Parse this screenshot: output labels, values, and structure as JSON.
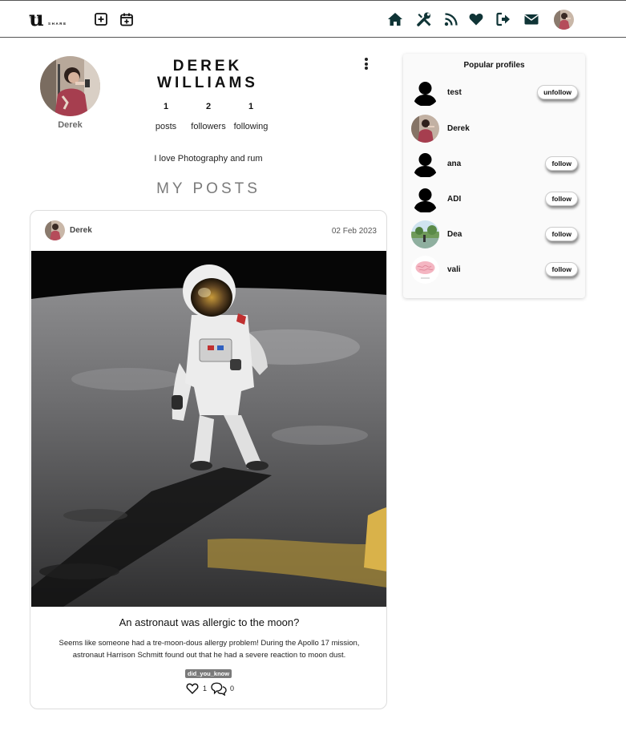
{
  "header": {
    "logo": {
      "big": "u",
      "small_top": "TAKE",
      "small_bottom": "SHARE"
    },
    "left_icons": [
      "add-post-icon",
      "add-event-icon"
    ],
    "right_icons": [
      "home-icon",
      "tools-icon",
      "rss-icon",
      "heart-icon",
      "logout-icon",
      "mail-icon"
    ],
    "colors": {
      "icon": "#0f3436"
    }
  },
  "profile": {
    "name": "DEREK WILLIAMS",
    "handle": "Derek",
    "stats": [
      {
        "value": "1",
        "label": "posts"
      },
      {
        "value": "2",
        "label": "followers"
      },
      {
        "value": "1",
        "label": "following"
      }
    ],
    "bio": "I love Photography and rum",
    "section_title": "MY POSTS"
  },
  "post": {
    "author": "Derek",
    "date": "02 Feb 2023",
    "title": "An astronaut was allergic to the moon?",
    "body": "Seems like someone had a tre-moon-dous allergy problem! During the Apollo 17 mission, astronaut Harrison Schmitt found out that he had a severe reaction to moon dust.",
    "tag": "did_you_know",
    "likes": "1",
    "comments": "0"
  },
  "popular": {
    "title": "Popular profiles",
    "profiles": [
      {
        "name": "test",
        "button": "unfollow",
        "avatar": "silhouette"
      },
      {
        "name": "Derek",
        "button": "",
        "avatar": "photo-person"
      },
      {
        "name": "ana",
        "button": "follow",
        "avatar": "silhouette"
      },
      {
        "name": "ADI",
        "button": "follow",
        "avatar": "silhouette"
      },
      {
        "name": "Dea",
        "button": "follow",
        "avatar": "photo-landscape"
      },
      {
        "name": "vali",
        "button": "follow",
        "avatar": "photo-brain"
      }
    ]
  }
}
